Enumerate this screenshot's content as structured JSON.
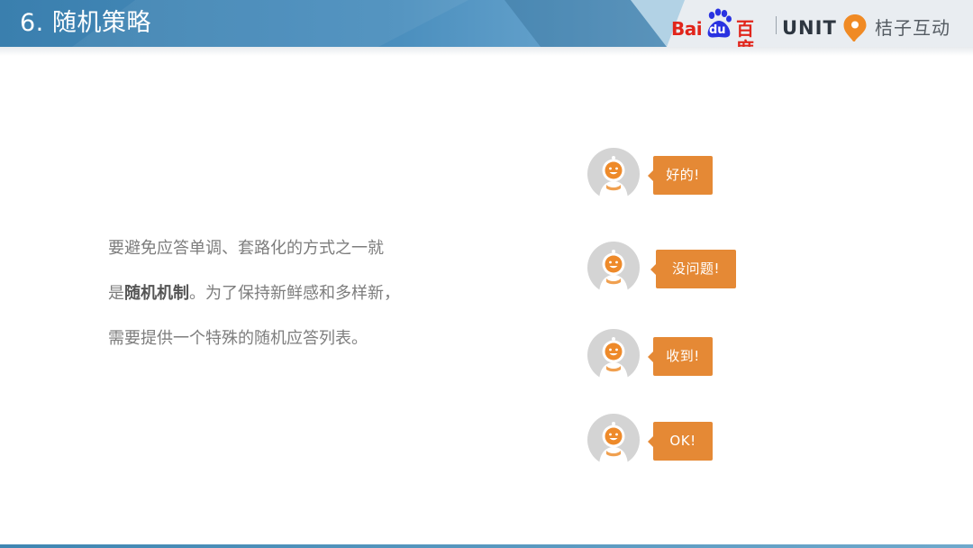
{
  "slide": {
    "title": "6. 随机策略"
  },
  "logos": {
    "baidu_bai": "Bai",
    "baidu_du": "du",
    "baidu_cn": "百度",
    "unit": "UNIT",
    "juzi": "桔子互动",
    "juzi_icon": "orange-speech-pin-icon",
    "paw_icon": "baidu-paw-icon"
  },
  "body": {
    "line1": "要避免应答单调、套路化的方式之一就",
    "line2_pre": "是",
    "line2_bold": "随机机制",
    "line2_post": "。为了保持新鲜感和多样新，",
    "line3": "需要提供一个特殊的随机应答列表。"
  },
  "responses": [
    {
      "text": "好的!"
    },
    {
      "text": "没问题!"
    },
    {
      "text": "收到!"
    },
    {
      "text": "OK!"
    }
  ],
  "colors": {
    "header_dark": "#2f6f9c",
    "header_light": "#6aa7cf",
    "bubble": "#e58935",
    "body_text": "#7d7d7d",
    "baidu_red": "#e1251b",
    "baidu_blue": "#2932e1"
  }
}
